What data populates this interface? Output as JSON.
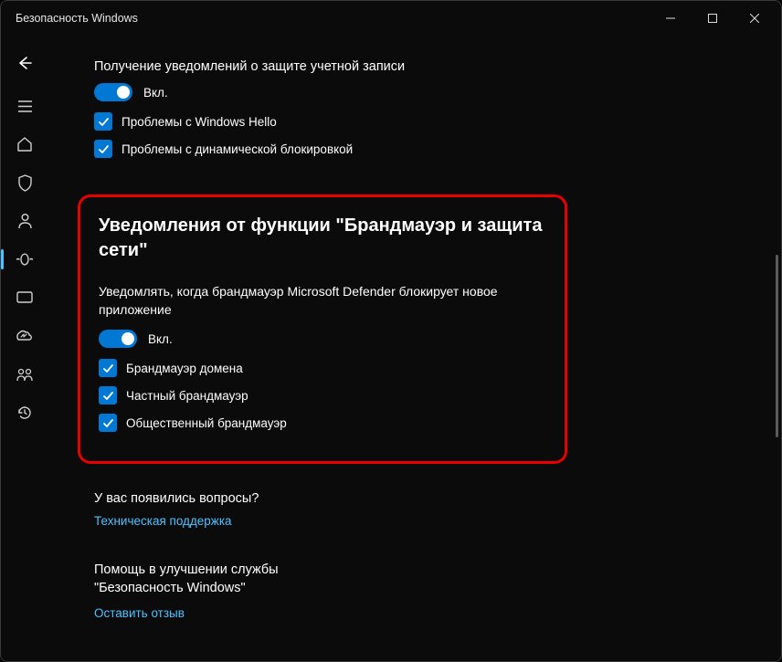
{
  "window": {
    "title": "Безопасность Windows"
  },
  "section_account": {
    "title": "Получение уведомлений о защите учетной записи",
    "toggle_label": "Вкл.",
    "check1": "Проблемы с Windows Hello",
    "check2": "Проблемы с динамической блокировкой"
  },
  "section_firewall": {
    "title": "Уведомления от функции \"Брандмауэр и защита сети\"",
    "desc": "Уведомлять, когда брандмауэр Microsoft Defender блокирует новое приложение",
    "toggle_label": "Вкл.",
    "check1": "Брандмауэр домена",
    "check2": "Частный брандмауэр",
    "check3": "Общественный брандмауэр"
  },
  "footer": {
    "q1": "У вас появились вопросы?",
    "link1": "Техническая поддержка",
    "q2": "Помощь в улучшении службы \"Безопасность Windows\"",
    "link2": "Оставить отзыв"
  }
}
